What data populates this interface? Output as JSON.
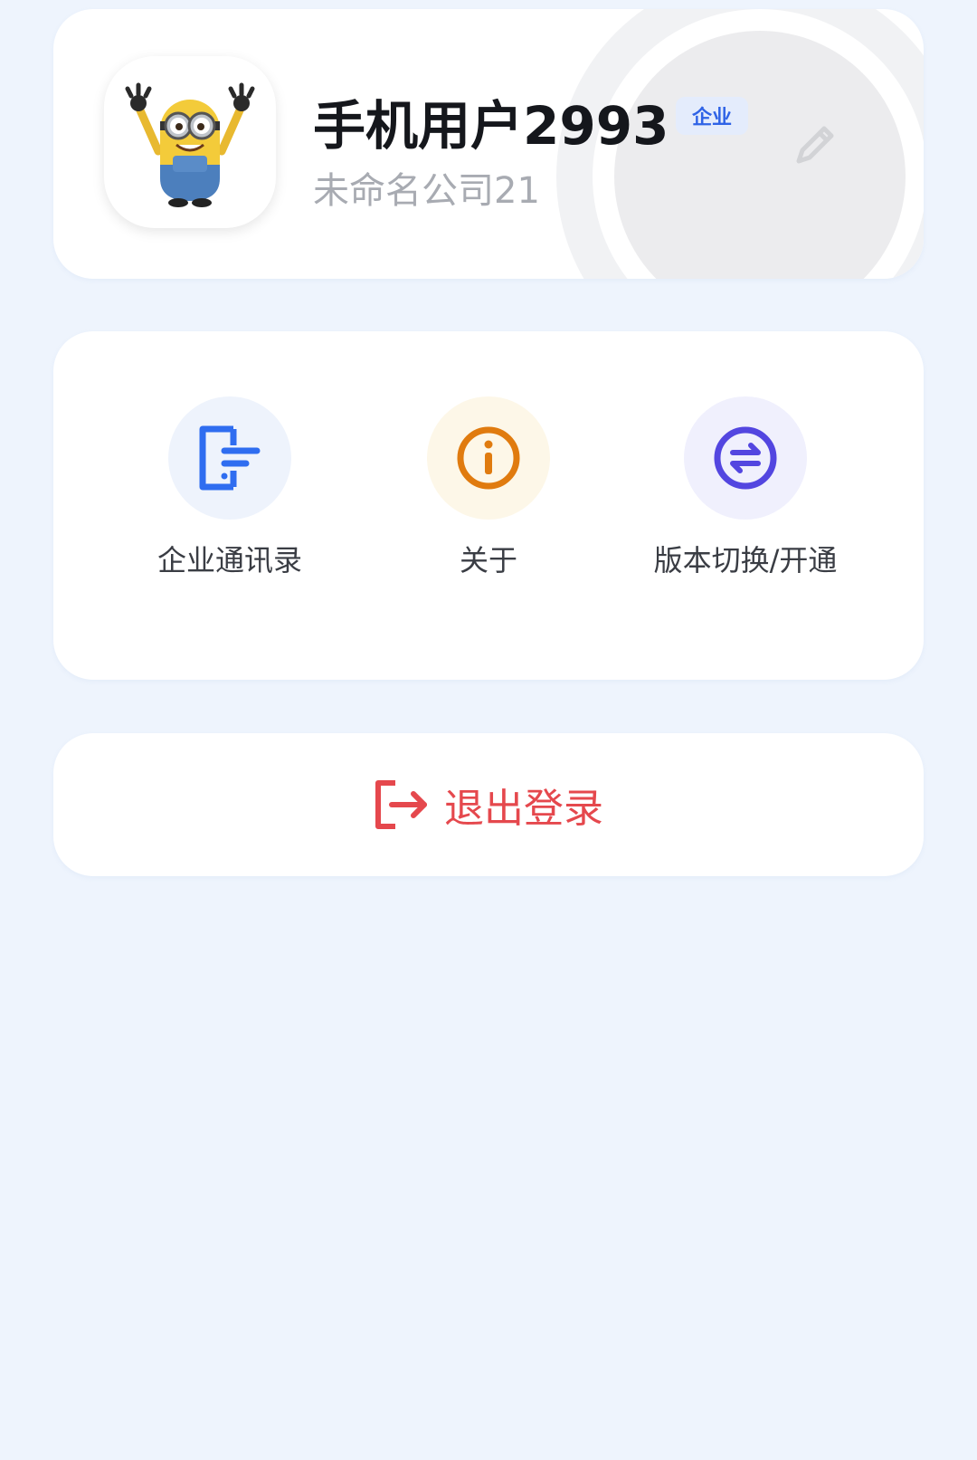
{
  "profile": {
    "name": "手机用户2993",
    "badge": "企业",
    "company": "未命名公司21"
  },
  "menu": {
    "items": [
      {
        "label": "企业通讯录",
        "icon": "contacts-book-icon",
        "icon_color": "#2f6df0",
        "bg_color": "#eef3fc"
      },
      {
        "label": "关于",
        "icon": "info-circle-icon",
        "icon_color": "#e07b0f",
        "bg_color": "#fdf7e8"
      },
      {
        "label": "版本切换/开通",
        "icon": "switch-arrows-icon",
        "icon_color": "#5346e0",
        "bg_color": "#f0f0fd"
      }
    ]
  },
  "logout": {
    "label": "退出登录",
    "icon": "logout-icon",
    "color": "#e5484d"
  },
  "colors": {
    "background": "#eef4fd",
    "card": "#ffffff",
    "accent": "#2f63e6"
  }
}
